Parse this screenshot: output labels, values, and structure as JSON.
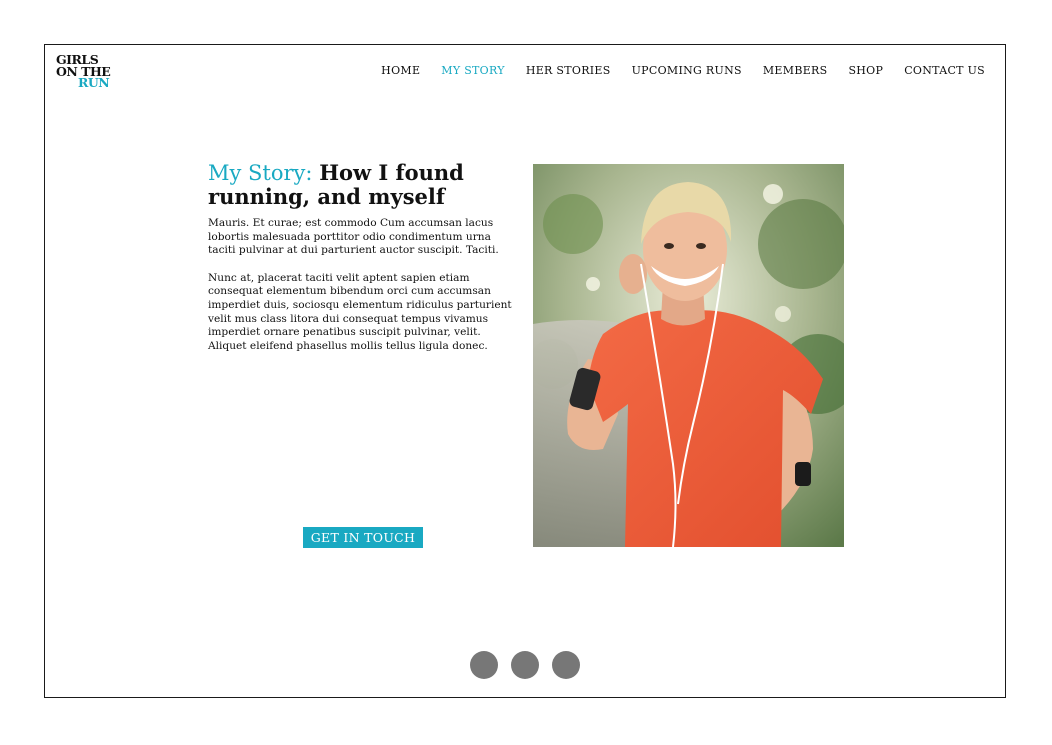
{
  "brand": {
    "logo_line1": "GIRLS",
    "logo_line2": "ON THE",
    "logo_line3": "RUN",
    "accent_color": "#19a9c2"
  },
  "nav": {
    "items": [
      {
        "label": "HOME",
        "active": false
      },
      {
        "label": "MY STORY",
        "active": true
      },
      {
        "label": "HER STORIES",
        "active": false
      },
      {
        "label": "UPCOMING RUNS",
        "active": false
      },
      {
        "label": "MEMBERS",
        "active": false
      },
      {
        "label": "SHOP",
        "active": false
      },
      {
        "label": "CONTACT US",
        "active": false
      }
    ]
  },
  "story": {
    "title_accent": "My Story:",
    "title_rest": "How I found running, and myself",
    "paragraph1": "Mauris. Et curae; est commodo Cum accumsan lacus lobortis malesuada porttitor odio condimentum urna taciti pulvinar at dui parturient auctor suscipit. Taciti.",
    "paragraph2": "Nunc at, placerat taciti velit aptent sapien etiam consequat elementum bibendum orci cum accumsan imperdiet duis, sociosqu elementum ridiculus parturient velit mus class litora dui consequat tempus vivamus imperdiet ornare penatibus suscipit pulvinar, velit. Aliquet eleifend phasellus mollis tellus ligula donec.",
    "cta_label": "GET IN TOUCH"
  },
  "photo": {
    "subject": "smiling woman runner in orange shirt with earphones"
  },
  "carousel": {
    "dots": 3,
    "dot_color": "#777777"
  }
}
